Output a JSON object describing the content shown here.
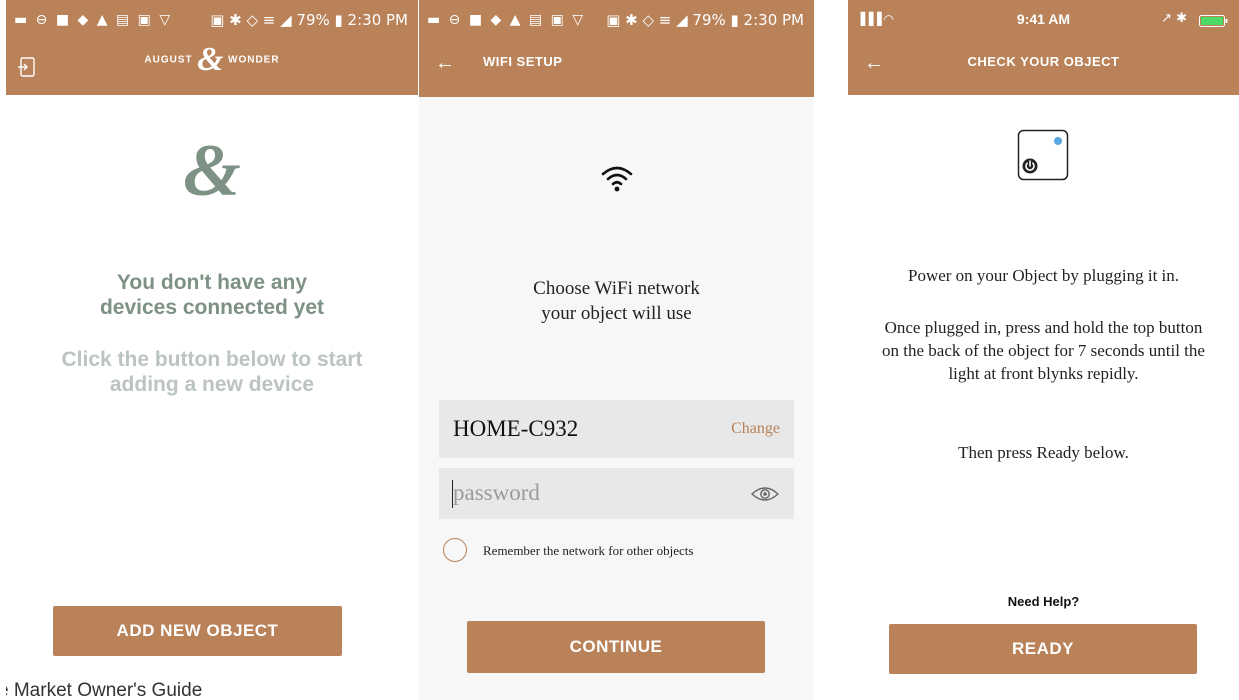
{
  "colors": {
    "brand": "#b98259",
    "sage": "#7e9185",
    "muted": "#bcc4bf",
    "field_bg": "#e8e8e8"
  },
  "screen1": {
    "status_left": "▬ ⊖ ■ ◆ ▲ ▤ ▣ ▽",
    "status_right": "▣ ✱ ◇ ≡ ◢ 79% ▮ 2:30 PM",
    "logo_left": "AUGUST",
    "logo_mark": "&",
    "logo_right": "WONDER",
    "emblem": "&",
    "heading": "You don't have any devices connected yet",
    "subheading": "Click the button below to start adding a new device",
    "button": "ADD NEW OBJECT",
    "footer_text": "e Market Owner's Guide",
    "icons": {
      "logout": "logout-icon"
    }
  },
  "screen2": {
    "status_left": "▬ ⊖ ■ ◆ ▲ ▤ ▣ ▽",
    "status_right": "▣ ✱ ◇ ≡ ◢ 79% ▮ 2:30 PM",
    "back_glyph": "←",
    "title": "WIFI SETUP",
    "prompt_line1": "Choose WiFi network",
    "prompt_line2": "your object will use",
    "network_name": "HOME-C932",
    "change_label": "Change",
    "password_placeholder": "password",
    "remember_label": "Remember the network for other objects",
    "button": "CONTINUE"
  },
  "screen3": {
    "status_left": "▐▐▐ ◠",
    "status_time": "9:41 AM",
    "status_right": "↗ ✱",
    "back_glyph": "←",
    "title": "CHECK YOUR OBJECT",
    "instruction1": "Power on your Object by plugging it in.",
    "instruction2": "Once plugged in, press and hold the top button on the back of the object for 7 seconds until the light at front blynks repidly.",
    "instruction3": "Then press Ready below.",
    "help_label": "Need Help?",
    "button": "READY"
  }
}
